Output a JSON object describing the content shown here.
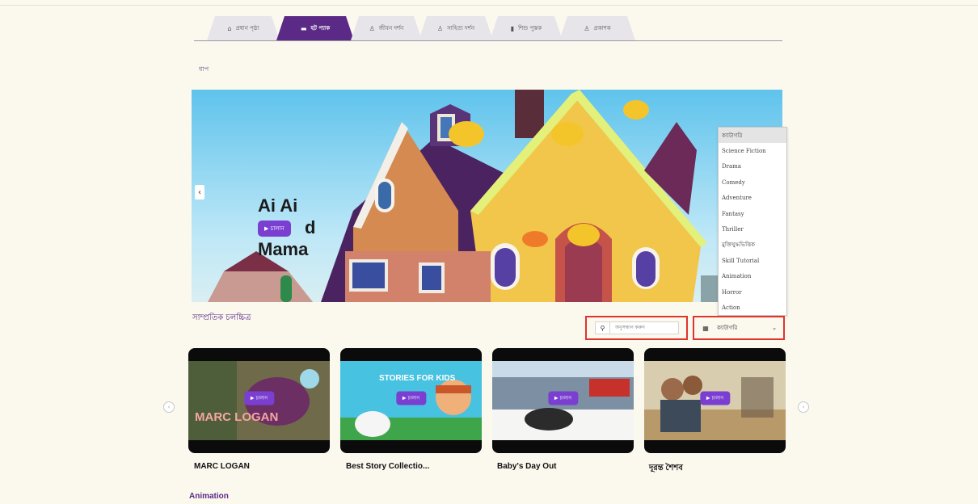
{
  "tabs": [
    {
      "label": "প্রধান পৃষ্ঠা",
      "icon": "home-icon",
      "glyph": "⌂"
    },
    {
      "label": "হট প্যাক",
      "icon": "book-icon",
      "glyph": "▬",
      "active": true
    },
    {
      "label": "জীবন দর্শন",
      "icon": "person-icon",
      "glyph": "♙"
    },
    {
      "label": "সাহিত্য দর্শন",
      "icon": "person-icon",
      "glyph": "♙"
    },
    {
      "label": "শিশু পুস্তক",
      "icon": "book-icon",
      "glyph": "▮"
    },
    {
      "label": "প্রকাশক",
      "icon": "user-icon",
      "glyph": "♙"
    }
  ],
  "breadcrumb": "ধাপ",
  "banner": {
    "title_line1": "Ai Ai",
    "title_line2": "d",
    "title_line3": "Mama",
    "play_label": "▶ চালান",
    "prev_glyph": "‹"
  },
  "genre_dropdown": {
    "items": [
      "ক্যাটাগরি",
      "Science Fiction",
      "Drama",
      "Comedy",
      "Adventure",
      "Fantasy",
      "Thriller",
      "মুক্তিযুদ্ধভিত্তিক",
      "Skill Tutorial",
      "Animation",
      "Horror",
      "Action"
    ],
    "selected_index": 0
  },
  "section_title": "সাম্প্রতিক চলচ্চিত্র",
  "search": {
    "placeholder": "অনুসন্ধান করুন",
    "icon": "search-icon"
  },
  "filter": {
    "value": "ক্যাটাগরি",
    "icon": "filter-icon",
    "chevron": "⌄"
  },
  "carousel": {
    "prev_glyph": "‹",
    "next_glyph": "›",
    "play_label": "▶ চালান",
    "cards": [
      {
        "title": "MARC LOGAN",
        "overlay": "MARC LOGAN"
      },
      {
        "title": "Best Story Collectio...",
        "overlay": "STORIES FOR KIDS"
      },
      {
        "title": "Baby's Day Out",
        "overlay": ""
      },
      {
        "title": "দূরন্ত শৈশব",
        "overlay": ""
      }
    ]
  },
  "footer_section": "Animation",
  "colors": {
    "accent": "#5b2a86",
    "play": "#7a3fd1",
    "highlight": "#e0342d",
    "page": "#fbf8ee"
  }
}
